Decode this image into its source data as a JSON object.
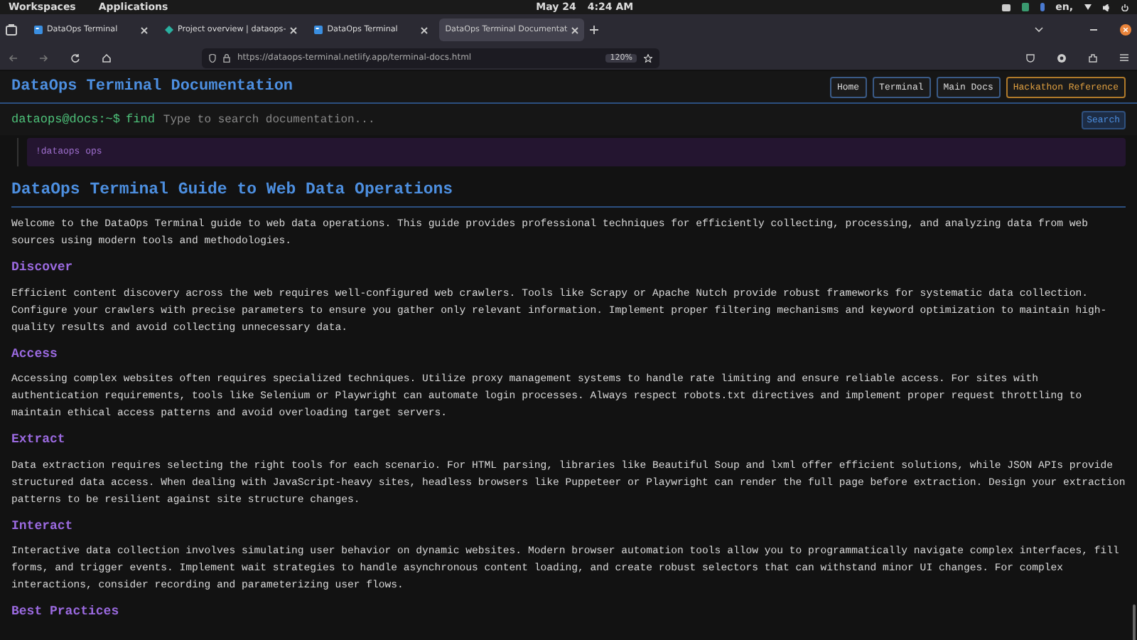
{
  "top_bar": {
    "menus": [
      "Workspaces",
      "Applications"
    ],
    "date": "May 24",
    "time": "4:24 AM",
    "keyboard_layout": "en,"
  },
  "tabs": [
    {
      "title": "DataOps Terminal",
      "kind": "square",
      "selected": false
    },
    {
      "title": "Project overview | dataops-",
      "kind": "diamond",
      "selected": false
    },
    {
      "title": "DataOps Terminal",
      "kind": "square",
      "selected": false
    },
    {
      "title": "DataOps Terminal Documentat",
      "kind": "plain",
      "selected": true
    }
  ],
  "address_bar": {
    "url": "https://dataops-terminal.netlify.app/terminal-docs.html",
    "zoom": "120%"
  },
  "header": {
    "title": "DataOps Terminal Documentation",
    "nav": [
      {
        "label": "Home",
        "highlighted": false
      },
      {
        "label": "Terminal",
        "highlighted": false
      },
      {
        "label": "Main Docs",
        "highlighted": false
      },
      {
        "label": "Hackathon Reference",
        "highlighted": true
      }
    ]
  },
  "search": {
    "prompt": "dataops@docs:~$",
    "command": "find",
    "placeholder": "Type to search documentation...",
    "button": "Search"
  },
  "result": "!dataops ops",
  "doc": {
    "title": "DataOps Terminal Guide to Web Data Operations",
    "intro": "Welcome to the DataOps Terminal guide to web data operations. This guide provides professional techniques for efficiently collecting, processing, and analyzing data from web sources using modern tools and methodologies.",
    "sections": [
      {
        "heading": "Discover",
        "text": "Efficient content discovery across the web requires well-configured web crawlers. Tools like Scrapy or Apache Nutch provide robust frameworks for systematic data collection. Configure your crawlers with precise parameters to ensure you gather only relevant information. Implement proper filtering mechanisms and keyword optimization to maintain high-quality results and avoid collecting unnecessary data."
      },
      {
        "heading": "Access",
        "text": "Accessing complex websites often requires specialized techniques. Utilize proxy management systems to handle rate limiting and ensure reliable access. For sites with authentication requirements, tools like Selenium or Playwright can automate login processes. Always respect robots.txt directives and implement proper request throttling to maintain ethical access patterns and avoid overloading target servers."
      },
      {
        "heading": "Extract",
        "text": "Data extraction requires selecting the right tools for each scenario. For HTML parsing, libraries like Beautiful Soup and lxml offer efficient solutions, while JSON APIs provide structured data access. When dealing with JavaScript-heavy sites, headless browsers like Puppeteer or Playwright can render the full page before extraction. Design your extraction patterns to be resilient against site structure changes."
      },
      {
        "heading": "Interact",
        "text": "Interactive data collection involves simulating user behavior on dynamic websites. Modern browser automation tools allow you to programmatically navigate complex interfaces, fill forms, and trigger events. Implement wait strategies to handle asynchronous content loading, and create robust selectors that can withstand minor UI changes. For complex interactions, consider recording and parameterizing user flows."
      },
      {
        "heading": "Best Practices"
      }
    ]
  }
}
